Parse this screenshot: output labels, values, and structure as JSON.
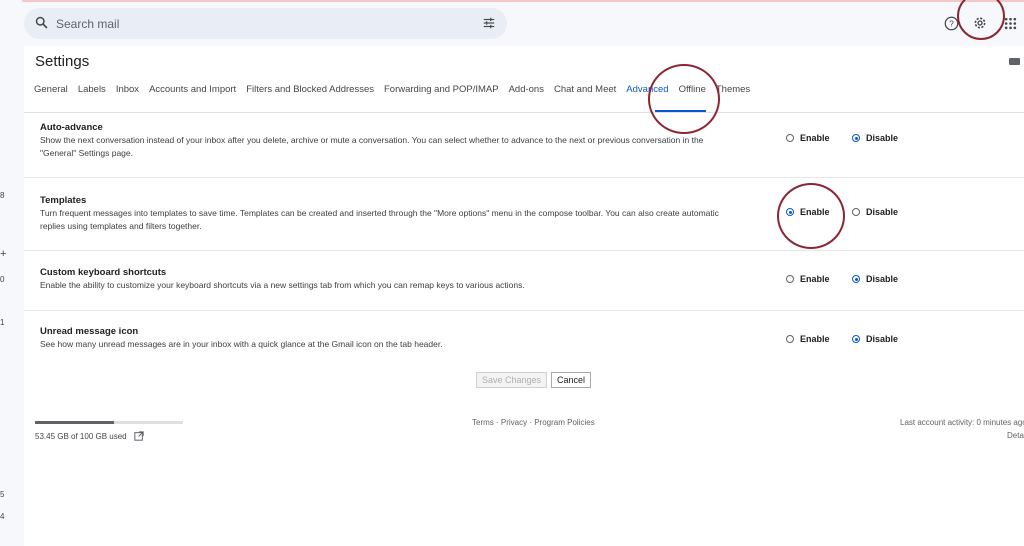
{
  "search": {
    "placeholder": "Search mail"
  },
  "header": {
    "icons": [
      "help-icon",
      "gear-icon",
      "apps-icon"
    ]
  },
  "left_numbers": [
    "8",
    "+",
    "0",
    "1",
    "5",
    "4"
  ],
  "settings": {
    "title": "Settings",
    "tabs": [
      "General",
      "Labels",
      "Inbox",
      "Accounts and Import",
      "Filters and Blocked Addresses",
      "Forwarding and POP/IMAP",
      "Add-ons",
      "Chat and Meet",
      "Advanced",
      "Offline",
      "Themes"
    ],
    "active_tab": "Advanced"
  },
  "sections": [
    {
      "title": "Auto-advance",
      "desc": "Show the next conversation instead of your inbox after you delete, archive or mute a conversation. You can select whether to advance to the next or previous conversation in the \"General\" Settings page.",
      "enable_label": "Enable",
      "disable_label": "Disable",
      "selected": "Disable"
    },
    {
      "title": "Templates",
      "desc": "Turn frequent messages into templates to save time. Templates can be created and inserted through the \"More options\" menu in the compose toolbar. You can also create automatic replies using templates and filters together.",
      "enable_label": "Enable",
      "disable_label": "Disable",
      "selected": "Enable"
    },
    {
      "title": "Custom keyboard shortcuts",
      "desc": "Enable the ability to customize your keyboard shortcuts via a new settings tab from which you can remap keys to various actions.",
      "enable_label": "Enable",
      "disable_label": "Disable",
      "selected": "Disable"
    },
    {
      "title": "Unread message icon",
      "desc": "See how many unread messages are in your inbox with a quick glance at the Gmail icon on the tab header.",
      "enable_label": "Enable",
      "disable_label": "Disable",
      "selected": "Disable"
    }
  ],
  "buttons": {
    "save": "Save Changes",
    "cancel": "Cancel"
  },
  "footer": {
    "storage_text": "53.45 GB of 100 GB used",
    "storage_fraction": 0.5345,
    "links": "Terms · Privacy · Program Policies",
    "activity": "Last account activity: 0 minutes ago",
    "details": "Deta"
  },
  "annotation_color": "#8c2633",
  "accent_color": "#0b57d0"
}
